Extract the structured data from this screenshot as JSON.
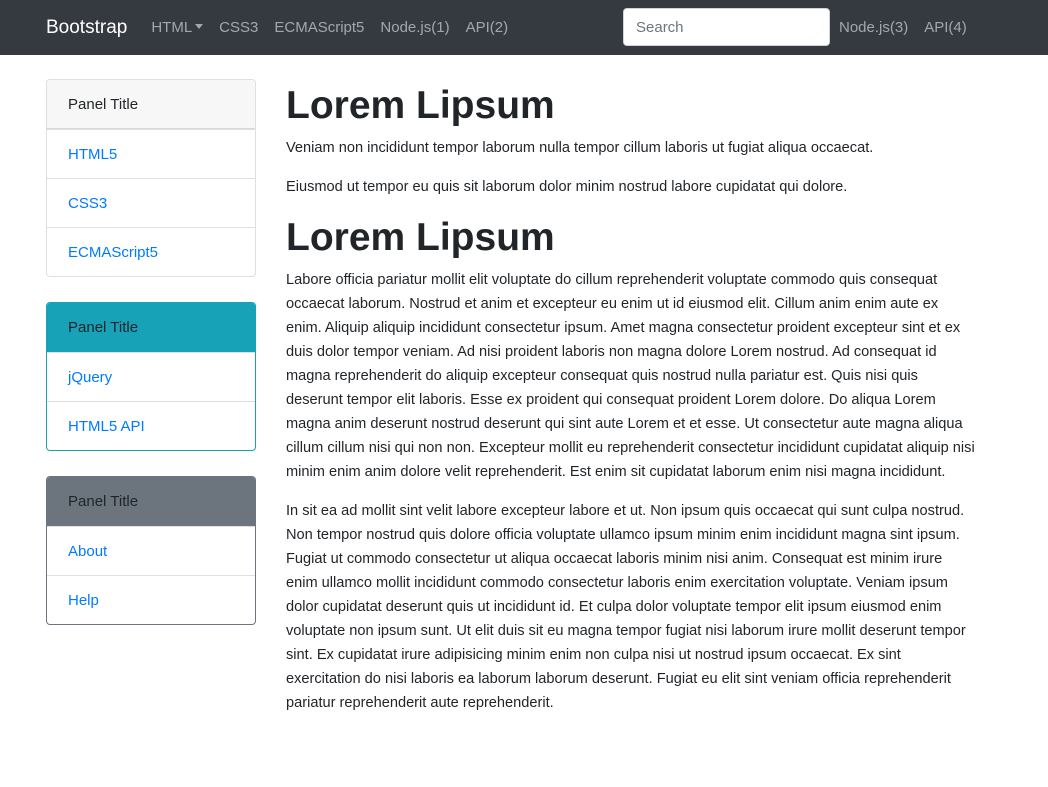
{
  "navbar": {
    "brand": "Bootstrap",
    "links": [
      "HTML",
      "CSS3",
      "ECMAScript5",
      "Node.js(1)",
      "API(2)"
    ],
    "search_placeholder": "Search",
    "right_links": [
      "Node.js(3)",
      "API(4)"
    ]
  },
  "sidebar": {
    "panels": [
      {
        "title": "Panel Title",
        "items": [
          "HTML5",
          "CSS3",
          "ECMAScript5"
        ]
      },
      {
        "title": "Panel Title",
        "items": [
          "jQuery",
          "HTML5 API"
        ],
        "color": "#17a2b8"
      },
      {
        "title": "Panel Title",
        "items": [
          "About",
          "Help"
        ],
        "color": "#6c757d"
      }
    ]
  },
  "main": {
    "heading1": "Lorem Lipsum",
    "p1": "Veniam non incididunt tempor laborum nulla tempor cillum laboris ut fugiat aliqua occaecat.",
    "p2": "Eiusmod ut tempor eu quis sit laborum dolor minim nostrud labore cupidatat qui dolore.",
    "heading2": "Lorem Lipsum",
    "p3": "Labore officia pariatur mollit elit voluptate do cillum reprehenderit voluptate commodo quis consequat occaecat laborum. Nostrud et anim et excepteur eu enim ut id eiusmod elit. Cillum anim enim aute ex enim. Aliquip aliquip incididunt consectetur ipsum. Amet magna consectetur proident excepteur sint et ex duis dolor tempor veniam. Ad nisi proident laboris non magna dolore Lorem nostrud. Ad consequat id magna reprehenderit do aliquip excepteur consequat quis nostrud nulla pariatur est. Quis nisi quis deserunt tempor elit laboris. Esse ex proident qui consequat proident Lorem dolore. Do aliqua Lorem magna anim deserunt nostrud deserunt qui sint aute Lorem et et esse. Ut consectetur aute magna aliqua cillum cillum nisi qui non non. Excepteur mollit eu reprehenderit consectetur incididunt cupidatat aliquip nisi minim enim anim dolore velit reprehenderit. Est enim sit cupidatat laborum enim nisi magna incididunt.",
    "p4": "In sit ea ad mollit sint velit labore excepteur labore et ut. Non ipsum quis occaecat qui sunt culpa nostrud. Non tempor nostrud quis dolore officia voluptate ullamco ipsum minim enim incididunt magna sint ipsum. Fugiat ut commodo consectetur ut aliqua occaecat laboris minim nisi anim. Consequat est minim irure enim ullamco mollit incididunt commodo consectetur laboris enim exercitation voluptate. Veniam ipsum dolor cupidatat deserunt quis ut incididunt id. Et culpa dolor voluptate tempor elit ipsum eiusmod enim voluptate non ipsum sunt. Ut elit duis sit eu magna tempor fugiat nisi laborum irure mollit deserunt tempor sint. Ex cupidatat irure adipisicing minim enim non culpa nisi ut nostrud ipsum occaecat. Ex sint exercitation do nisi laboris ea laborum laborum deserunt. Fugiat eu elit sint veniam officia reprehenderit pariatur reprehenderit aute reprehenderit."
  }
}
